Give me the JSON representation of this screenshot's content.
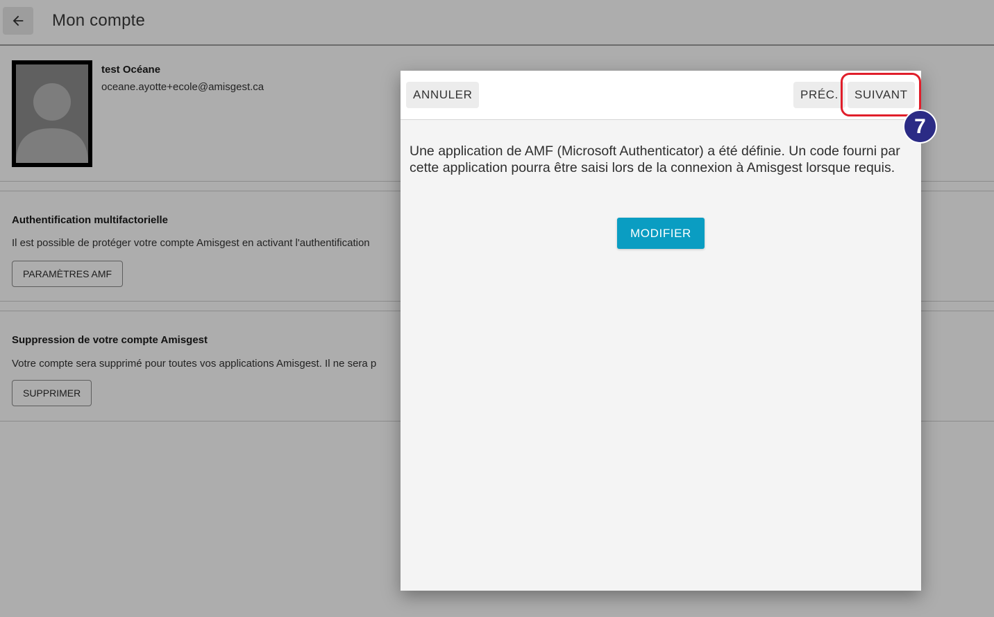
{
  "page": {
    "title": "Mon compte",
    "user": {
      "name": "test Océane",
      "email": "oceane.ayotte+ecole@amisgest.ca"
    },
    "mfa_section": {
      "title": "Authentification multifactorielle",
      "text": "Il est possible de protéger votre compte Amisgest en activant l'authentification",
      "button_label": "PARAMÈTRES AMF"
    },
    "delete_section": {
      "title": "Suppression de votre compte Amisgest",
      "text": "Votre compte sera supprimé pour toutes vos applications Amisgest. Il ne sera p",
      "button_label": "SUPPRIMER"
    }
  },
  "dialog": {
    "cancel_label": "ANNULER",
    "prev_label": "PRÉC.",
    "next_label": "SUIVANT",
    "message": "Une application de AMF (Microsoft Authenticator) a été définie. Un code fourni par cette application pourra être saisi lors de la connexion à Amisgest lorsque requis.",
    "modify_label": "MODIFIER"
  },
  "annotation": {
    "step_number": "7",
    "highlight_color": "#e01e2a",
    "badge_color": "#2b2b85"
  },
  "colors": {
    "primary": "#0a9dc2",
    "overlay": "rgba(0,0,0,0.32)"
  }
}
